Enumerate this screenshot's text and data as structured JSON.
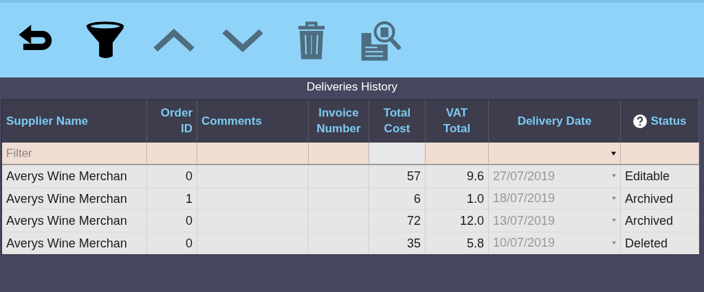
{
  "toolbar": [
    {
      "kind": "undo",
      "disabled": false
    },
    {
      "kind": "filter",
      "disabled": false
    },
    {
      "kind": "up",
      "disabled": true
    },
    {
      "kind": "down",
      "disabled": true
    },
    {
      "kind": "delete",
      "disabled": true
    },
    {
      "kind": "search",
      "disabled": true
    }
  ],
  "title": "Deliveries History",
  "table": {
    "columns": [
      {
        "label": "Supplier Name",
        "help": false
      },
      {
        "label": "Order ID",
        "help": false
      },
      {
        "label": "Comments",
        "help": false
      },
      {
        "label": "Invoice Number",
        "help": false
      },
      {
        "label": "Total Cost",
        "help": false
      },
      {
        "label": "VAT Total",
        "help": false
      },
      {
        "label": "Delivery Date",
        "help": false
      },
      {
        "label": "Status",
        "help": true
      }
    ],
    "filters": [
      {
        "kind": "text",
        "placeholder": "Filter",
        "disabled": false
      },
      {
        "kind": "text",
        "disabled": false
      },
      {
        "kind": "text",
        "disabled": false
      },
      {
        "kind": "text",
        "disabled": false
      },
      {
        "kind": "text",
        "disabled": true
      },
      {
        "kind": "text",
        "disabled": false
      },
      {
        "kind": "dropdown",
        "disabled": false
      },
      {
        "kind": "text",
        "disabled": false
      }
    ],
    "rows": [
      {
        "supplier": "Averys Wine Merchan",
        "order_id": "0",
        "total_cost": "57",
        "vat_total": "9.6",
        "delivery_date": "27/07/2019",
        "status": "Editable"
      },
      {
        "supplier": "Averys Wine Merchan",
        "order_id": "1",
        "total_cost": "6",
        "vat_total": "1.0",
        "delivery_date": "18/07/2019",
        "status": "Archived"
      },
      {
        "supplier": "Averys Wine Merchan",
        "order_id": "0",
        "total_cost": "72",
        "vat_total": "12.0",
        "delivery_date": "13/07/2019",
        "status": "Archived"
      },
      {
        "supplier": "Averys Wine Merchan",
        "order_id": "0",
        "total_cost": "35",
        "vat_total": "5.8",
        "delivery_date": "10/07/2019",
        "status": "Deleted"
      }
    ]
  }
}
